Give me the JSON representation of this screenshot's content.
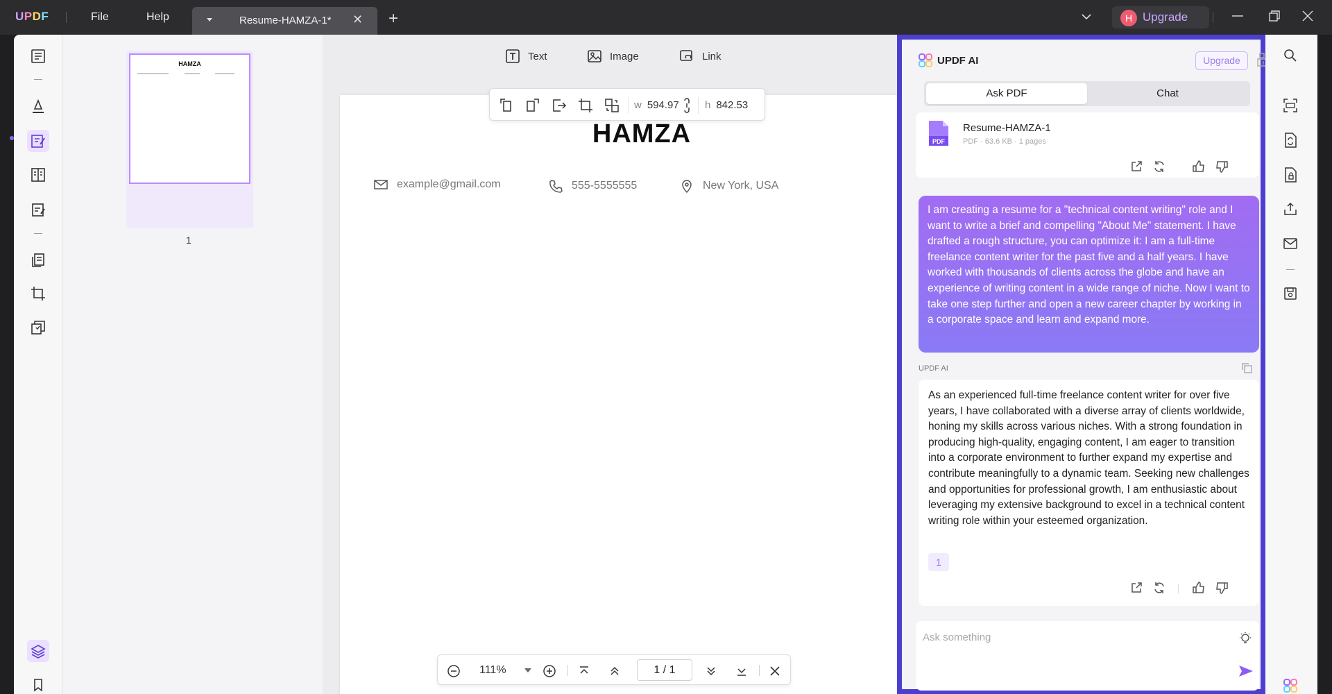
{
  "app": {
    "logo": {
      "l1": "U",
      "l2": "P",
      "l3": "D",
      "l4": "F"
    },
    "menu": {
      "file": "File",
      "help": "Help"
    },
    "tab_title": "Resume-HAMZA-1*",
    "new_tab": "+",
    "close_tab": "✕",
    "avatar_initial": "H",
    "upgrade_label": "Upgrade"
  },
  "edit_toolbar": {
    "text": "Text",
    "image": "Image",
    "link": "Link"
  },
  "image_toolbar": {
    "w_label": "w",
    "w_value": "594.97",
    "h_label": "h",
    "h_value": "842.53"
  },
  "thumbnails": {
    "title": "HAMZA",
    "page_label": "1"
  },
  "document": {
    "name": "HAMZA",
    "email": "example@gmail.com",
    "phone": "555-5555555",
    "location": "New York, USA"
  },
  "page_nav": {
    "zoom": "111%",
    "page_current": "1",
    "page_sep": "/",
    "page_total": "1"
  },
  "ai": {
    "title": "UPDF AI",
    "upgrade": "Upgrade",
    "tabs": {
      "ask_pdf": "Ask PDF",
      "chat": "Chat"
    },
    "file": {
      "name": "Resume-HAMZA-1",
      "meta": "PDF · 63.6 KB · 1 pages",
      "badge": "PDF"
    },
    "user_message": "I am creating a resume for a \"technical content writing\" role and I want to write a brief and compelling \"About Me\" statement. I have drafted a rough structure, you can optimize it: I am a full-time freelance content writer for the past five and a half years. I have worked with thousands of clients across the globe and have an experience of writing content in a wide range of niche. Now I want to take one step further and open a new career chapter by working in a corporate space and learn and expand more.",
    "ai_label": "UPDF AI",
    "ai_response": "As an experienced full-time freelance content writer for over five years, I have collaborated with a diverse array of clients worldwide, honing my skills across various niches. With a strong foundation in producing high-quality, engaging content, I am eager to transition into a corporate environment to further expand my expertise and contribute meaningfully to a dynamic team. Seeking new challenges and opportunities for professional growth, I am enthusiastic about leveraging my extensive background to excel in a technical content writing role within your esteemed organization.",
    "citation": "1",
    "input_placeholder": "Ask something"
  },
  "colors": {
    "accent": "#8b5cf6",
    "panel_border": "#4c3fd0",
    "bubble_start": "#a26cf2",
    "bubble_end": "#8a7af5"
  }
}
